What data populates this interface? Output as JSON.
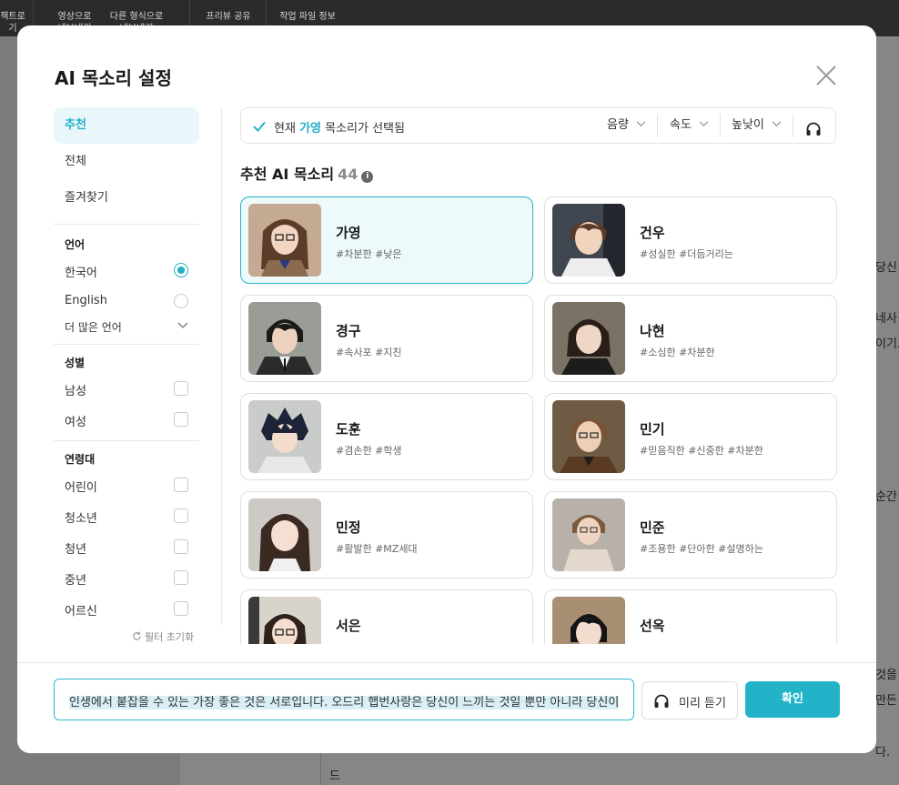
{
  "toolbar": {
    "items": [
      {
        "label": "젝트로\n기"
      },
      {
        "label": "영상으로\n내보내기"
      },
      {
        "label": "다른 형식으로\n내보내기"
      },
      {
        "label": "프리뷰 공유"
      },
      {
        "label": "작업 파일 정보"
      }
    ]
  },
  "background_text": [
    "당신",
    "네사",
    "이기.",
    "순간",
    "것을",
    "만든",
    "다.",
    "드"
  ],
  "modal": {
    "title": "AI 목소리 설정",
    "nav": [
      "추천",
      "전체",
      "즐겨찾기"
    ],
    "language": {
      "heading": "언어",
      "options": [
        {
          "label": "한국어",
          "selected": true
        },
        {
          "label": "English",
          "selected": false
        }
      ],
      "more": "더 많은 언어"
    },
    "gender": {
      "heading": "성별",
      "options": [
        "남성",
        "여성"
      ]
    },
    "age": {
      "heading": "연령대",
      "options": [
        "어린이",
        "청소년",
        "청년",
        "중년",
        "어르신"
      ]
    },
    "reset": "필터 초기화",
    "status": {
      "prefix": "현재",
      "voice": "가영",
      "suffix": "목소리가 선택됨"
    },
    "controls": [
      "음량",
      "속도",
      "높낮이"
    ],
    "section": {
      "title": "추천 AI 목소리",
      "count": "44"
    },
    "voices": [
      {
        "name": "가영",
        "tags": "#차분한 #낮은",
        "selected": true
      },
      {
        "name": "건우",
        "tags": "#성실한 #더듬거리는"
      },
      {
        "name": "경구",
        "tags": "#속사포 #지친"
      },
      {
        "name": "나현",
        "tags": "#소심한 #차분한"
      },
      {
        "name": "도훈",
        "tags": "#겸손한 #학생"
      },
      {
        "name": "민기",
        "tags": "#믿음직한 #신중한 #차분한"
      },
      {
        "name": "민정",
        "tags": "#활발한 #MZ세대"
      },
      {
        "name": "민준",
        "tags": "#조용한 #단아한 #설명하는"
      },
      {
        "name": "서은",
        "tags": ""
      },
      {
        "name": "선옥",
        "tags": ""
      }
    ],
    "sample_text": "인생에서 붙잡을 수 있는 가장 좋은 것은 서로입니다. 오드리 햅번사랑은 당신이 느끼는 것일 뿐만 아니라 당신이",
    "preview_label": "미리 듣기",
    "confirm_label": "확인"
  },
  "colors": {
    "accent": "#22b3c9",
    "selected_bg": "#edf9fb"
  }
}
